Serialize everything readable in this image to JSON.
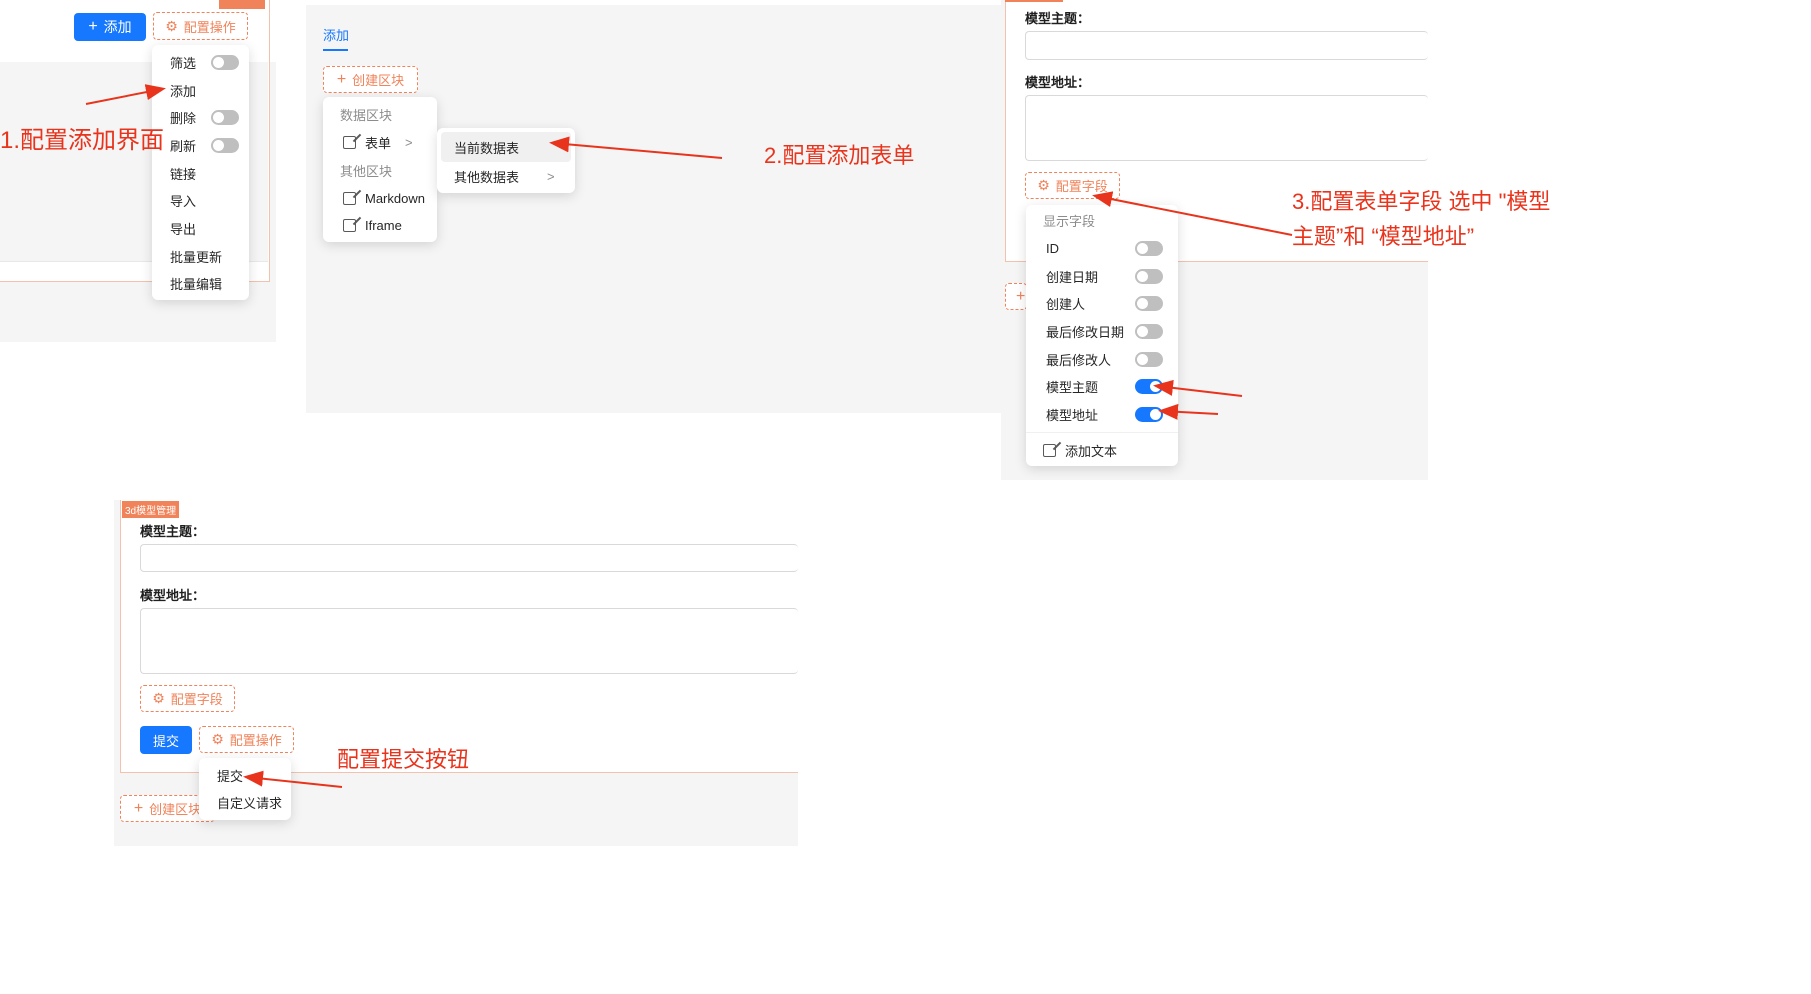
{
  "panel1": {
    "add_button": "添加",
    "config_actions": "配置操作",
    "menu": [
      {
        "label": "筛选",
        "toggle": false
      },
      {
        "label": "添加",
        "toggle": null
      },
      {
        "label": "删除",
        "toggle": false
      },
      {
        "label": "刷新",
        "toggle": false
      },
      {
        "label": "链接",
        "toggle": null
      },
      {
        "label": "导入",
        "toggle": null
      },
      {
        "label": "导出",
        "toggle": null
      },
      {
        "label": "批量更新",
        "toggle": null
      },
      {
        "label": "批量编辑",
        "toggle": null
      }
    ],
    "annotation": "1.配置添加界面"
  },
  "panel2": {
    "tab": "添加",
    "create_block": "创建区块",
    "menu": {
      "group_data": "数据区块",
      "form": "表单",
      "group_other": "其他区块",
      "markdown": "Markdown",
      "iframe": "Iframe"
    },
    "submenu": {
      "current": "当前数据表",
      "other": "其他数据表"
    },
    "annotation": "2.配置添加表单"
  },
  "panel3": {
    "field1_label": "模型主题：",
    "field2_label": "模型地址：",
    "config_fields": "配置字段",
    "menu_group": "显示字段",
    "fields": [
      {
        "label": "ID",
        "on": false
      },
      {
        "label": "创建日期",
        "on": false
      },
      {
        "label": "创建人",
        "on": false
      },
      {
        "label": "最后修改日期",
        "on": false
      },
      {
        "label": "最后修改人",
        "on": false
      },
      {
        "label": "模型主题",
        "on": true
      },
      {
        "label": "模型地址",
        "on": true
      }
    ],
    "add_text": "添加文本",
    "annotation_line1": "3.配置表单字段 选中 \"模型",
    "annotation_line2": "主题”和 “模型地址”"
  },
  "panel4": {
    "tag": "3d模型管理",
    "field1_label": "模型主题：",
    "field2_label": "模型地址：",
    "config_fields": "配置字段",
    "submit": "提交",
    "config_actions": "配置操作",
    "menu": [
      "提交",
      "自定义请求"
    ],
    "create_block": "创建区块",
    "annotation": "配置提交按钮"
  },
  "colors": {
    "primary": "#1677ff",
    "accent": "#f0835a",
    "annotation": "#e8341c"
  }
}
